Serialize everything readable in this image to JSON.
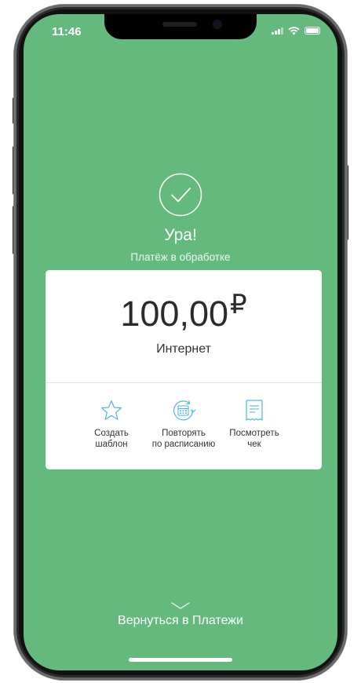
{
  "status_bar": {
    "time": "11:46"
  },
  "result": {
    "title": "Ура!",
    "subtitle": "Платёж в обработке"
  },
  "payment": {
    "amount": "100,00",
    "currency": "₽",
    "service": "Интернет"
  },
  "actions": [
    {
      "line1": "Создать",
      "line2": "шаблон",
      "icon": "star-icon"
    },
    {
      "line1": "Повторять",
      "line2": "по расписанию",
      "icon": "calendar-repeat-icon"
    },
    {
      "line1": "Посмотреть",
      "line2": "чек",
      "icon": "receipt-icon"
    }
  ],
  "footer": {
    "back_label": "Вернуться в Платежи"
  },
  "colors": {
    "background": "#64b97c",
    "card": "#ffffff",
    "icon_accent": "#4fb8e0",
    "text_dark": "#2b2b2b"
  }
}
